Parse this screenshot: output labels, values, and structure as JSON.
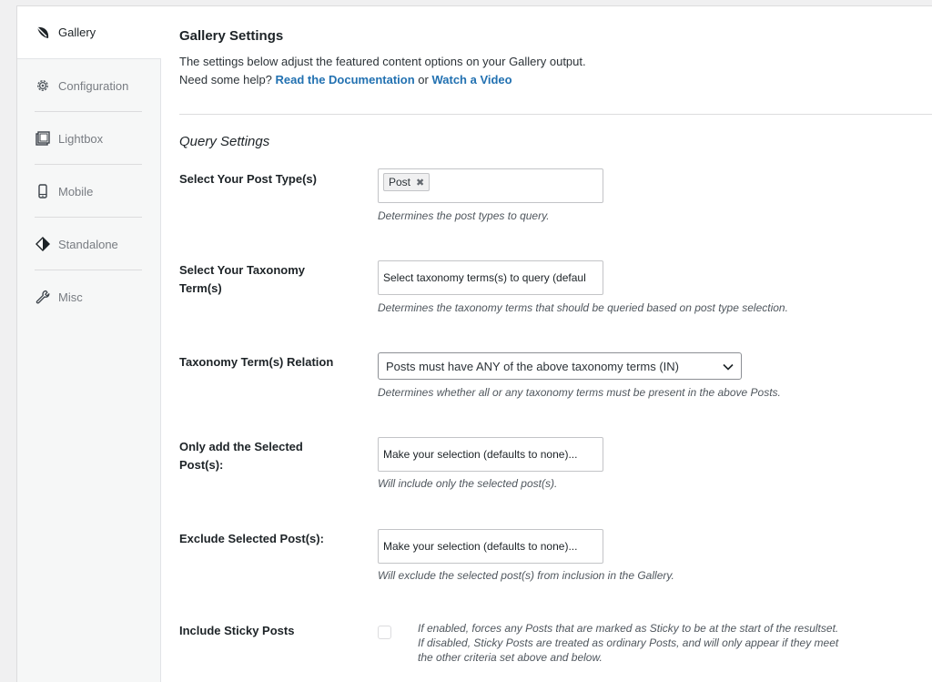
{
  "sidebar": {
    "items": [
      {
        "label": "Gallery",
        "icon": "leaf-icon",
        "active": true
      },
      {
        "label": "Configuration",
        "icon": "gear-icon"
      },
      {
        "label": "Lightbox",
        "icon": "lightbox-icon"
      },
      {
        "label": "Mobile",
        "icon": "mobile-icon"
      },
      {
        "label": "Standalone",
        "icon": "standalone-icon"
      },
      {
        "label": "Misc",
        "icon": "wrench-icon"
      }
    ]
  },
  "header": {
    "title": "Gallery Settings",
    "desc_line1": "The settings below adjust the featured content options on your Gallery output.",
    "help_prefix": "Need some help?",
    "doc_link": "Read the Documentation",
    "or_text": "or",
    "video_link": "Watch a Video"
  },
  "section_title": "Query Settings",
  "fields": {
    "post_type": {
      "label": "Select Your Post Type(s)",
      "tag": "Post",
      "help": "Determines the post types to query."
    },
    "taxonomy_terms": {
      "label": "Select Your Taxonomy Term(s)",
      "placeholder": "Select taxonomy terms(s) to query (defaul",
      "help": "Determines the taxonomy terms that should be queried based on post type selection."
    },
    "taxonomy_relation": {
      "label": "Taxonomy Term(s) Relation",
      "value": "Posts must have ANY of the above taxonomy terms (IN)",
      "help": "Determines whether all or any taxonomy terms must be present in the above Posts."
    },
    "only_selected": {
      "label": "Only add the Selected Post(s):",
      "placeholder": "Make your selection (defaults to none)...",
      "help": "Will include only the selected post(s)."
    },
    "exclude_selected": {
      "label": "Exclude Selected Post(s):",
      "placeholder": "Make your selection (defaults to none)...",
      "help": "Will exclude the selected post(s) from inclusion in the Gallery."
    },
    "sticky": {
      "label": "Include Sticky Posts",
      "checked": false,
      "help": "If enabled, forces any Posts that are marked as Sticky to be at the start of the resultset. If disabled, Sticky Posts are treated as ordinary Posts, and will only appear if they meet the other criteria set above and below."
    }
  },
  "colors": {
    "link": "#2271b1",
    "text": "#1d2327",
    "sidebar_bg": "#f6f7f7",
    "page_bg": "#f0f0f1"
  }
}
